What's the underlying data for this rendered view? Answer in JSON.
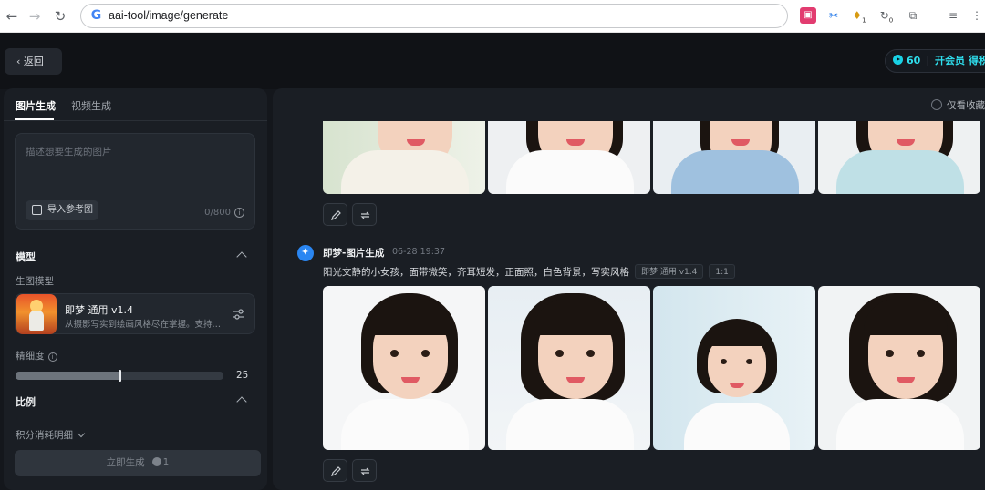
{
  "browser": {
    "url": "aai-tool/image/generate",
    "ext_badge_1": "1",
    "ext_badge_2": "0"
  },
  "appbar": {
    "back_label": "返回",
    "credits": "60",
    "vip_label": "开会员 得积分"
  },
  "left": {
    "tabs": [
      {
        "label": "图片生成"
      },
      {
        "label": "视频生成"
      }
    ],
    "prompt_placeholder": "描述想要生成的图片",
    "ref_button": "导入参考图",
    "counter": "0/800",
    "model_section": "模型",
    "model_sub_label": "生图模型",
    "model": {
      "name": "即梦 通用 v1.4",
      "desc": "从摄影写实到绘画风格尽在掌握。支持…"
    },
    "detail_label": "精细度",
    "detail_value": "25",
    "detail_fraction": 0.5,
    "ratio_section": "比例",
    "points_link": "积分消耗明细",
    "generate_button": "立即生成",
    "generate_cost": "1"
  },
  "right": {
    "fav_toggle": "仅看收藏",
    "message": {
      "name": "即梦-图片生成",
      "time": "06-28  19:37",
      "prompt": "阳光文静的小女孩，面带微笑，齐耳短发，正面照，白色背景，写实风格",
      "tag_model": "即梦 通用 v1.4",
      "tag_ratio": "1:1"
    }
  },
  "colors": {
    "accent": "#2fe0ef",
    "panel": "#1a1e24",
    "background": "#14171c"
  }
}
